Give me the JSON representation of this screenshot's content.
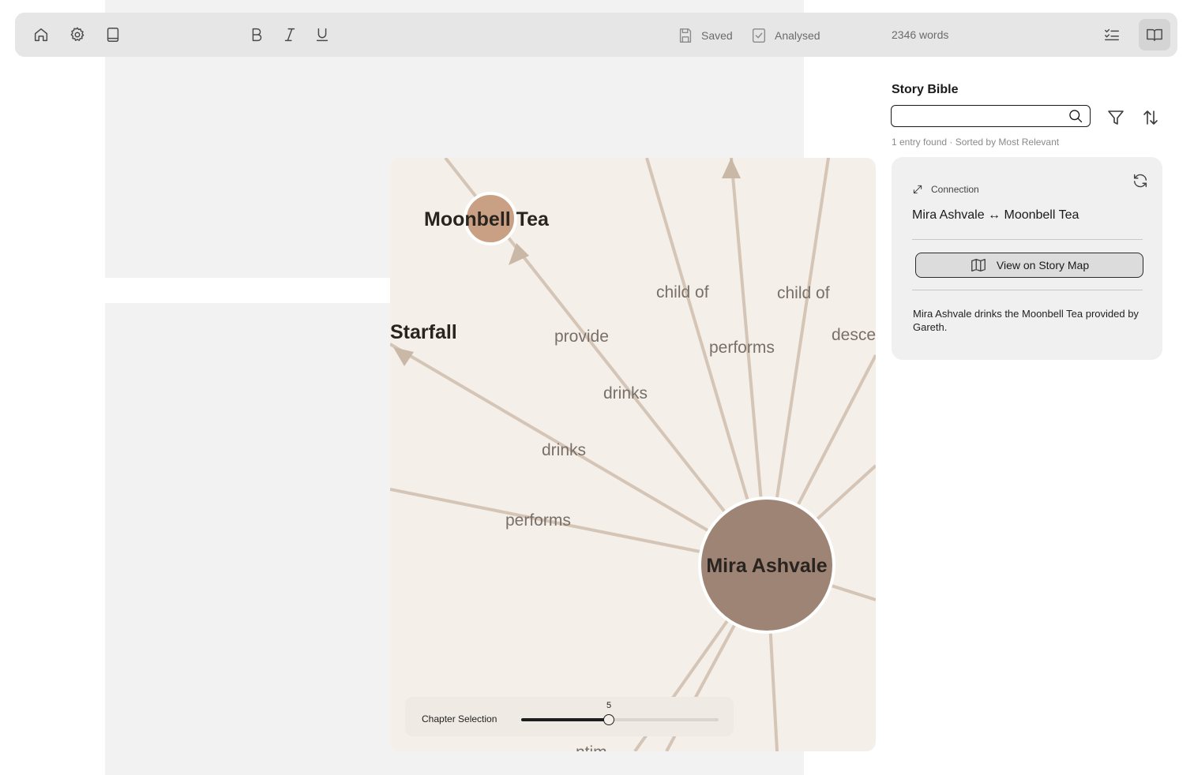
{
  "toolbar": {
    "status_saved": "Saved",
    "status_analysed": "Analysed",
    "word_count": "2346 words"
  },
  "story_map": {
    "nodes": [
      {
        "id": "moonbell",
        "label": "Moonbell Tea",
        "color": "#c9a083"
      },
      {
        "id": "mira",
        "label": "Mira Ashvale",
        "color": "#9e8474"
      },
      {
        "id": "starfall",
        "label": "Starfall",
        "color": ""
      }
    ],
    "edge_labels": [
      "child of",
      "child of",
      "provide",
      "performs",
      "desce",
      "drinks",
      "drinks",
      "performs",
      "ntim"
    ],
    "chapter_selection": {
      "label": "Chapter Selection",
      "value": 5,
      "min": 1,
      "max": 10
    }
  },
  "sidebar": {
    "title": "Story Bible",
    "search": {
      "value": "",
      "placeholder": ""
    },
    "result_meta": "1 entry found · Sorted by Most Relevant",
    "card": {
      "type_label": "Connection",
      "title": "Mira Ashvale ↔ Moonbell Tea",
      "button_label": "View on Story Map",
      "description": "Mira Ashvale drinks the Moonbell Tea provided by Gareth."
    }
  }
}
